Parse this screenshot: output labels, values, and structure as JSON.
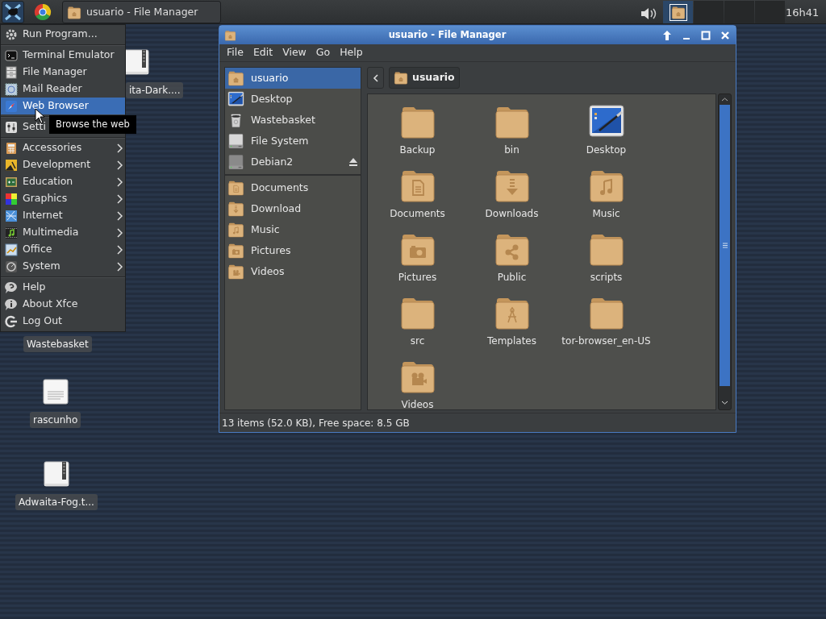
{
  "panel": {
    "task_button": {
      "label": "usuario - File Manager",
      "selected": false
    },
    "workspaces": [
      {
        "selected": true
      },
      {
        "selected": false
      },
      {
        "selected": false
      },
      {
        "selected": false
      }
    ],
    "clock": "16h41"
  },
  "desktop_icons": [
    {
      "label": "ita-Dark....",
      "kind": "archive"
    },
    {
      "label": "Wastebasket",
      "kind": "covered"
    },
    {
      "label": "rascunho",
      "kind": "text"
    },
    {
      "label": "Adwaita-Fog.t...",
      "kind": "archive"
    }
  ],
  "app_menu": {
    "sections": [
      [
        {
          "label": "Run Program...",
          "selected": false,
          "submenu": false
        }
      ],
      [
        {
          "label": "Terminal Emulator",
          "selected": false,
          "submenu": false
        },
        {
          "label": "File Manager",
          "selected": false,
          "submenu": false
        },
        {
          "label": "Mail Reader",
          "selected": false,
          "submenu": false
        },
        {
          "label": "Web Browser",
          "selected": true,
          "submenu": false
        }
      ],
      [
        {
          "label": "Setti",
          "selected": false,
          "submenu": false
        }
      ],
      [
        {
          "label": "Accessories",
          "selected": false,
          "submenu": true
        },
        {
          "label": "Development",
          "selected": false,
          "submenu": true
        },
        {
          "label": "Education",
          "selected": false,
          "submenu": true
        },
        {
          "label": "Graphics",
          "selected": false,
          "submenu": true
        },
        {
          "label": "Internet",
          "selected": false,
          "submenu": true
        },
        {
          "label": "Multimedia",
          "selected": false,
          "submenu": true
        },
        {
          "label": "Office",
          "selected": false,
          "submenu": true
        },
        {
          "label": "System",
          "selected": false,
          "submenu": true
        }
      ],
      [
        {
          "label": "Help",
          "selected": false,
          "submenu": false
        },
        {
          "label": "About Xfce",
          "selected": false,
          "submenu": false
        },
        {
          "label": "Log Out",
          "selected": false,
          "submenu": false
        }
      ]
    ]
  },
  "tooltip": "Browse the web",
  "file_manager": {
    "title": "usuario - File Manager",
    "menu": [
      "File",
      "Edit",
      "View",
      "Go",
      "Help"
    ],
    "sidebar": [
      [
        {
          "label": "usuario",
          "kind": "home",
          "selected": true,
          "eject": false
        },
        {
          "label": "Desktop",
          "kind": "desktop",
          "selected": false,
          "eject": false
        },
        {
          "label": "Wastebasket",
          "kind": "trash",
          "selected": false,
          "eject": false
        },
        {
          "label": "File System",
          "kind": "drive",
          "selected": false,
          "eject": false
        },
        {
          "label": "Debian2",
          "kind": "disk",
          "selected": false,
          "eject": true
        }
      ],
      [
        {
          "label": "Documents",
          "kind": "documents",
          "selected": false,
          "eject": false
        },
        {
          "label": "Download",
          "kind": "downloads",
          "selected": false,
          "eject": false
        },
        {
          "label": "Music",
          "kind": "music",
          "selected": false,
          "eject": false
        },
        {
          "label": "Pictures",
          "kind": "pictures",
          "selected": false,
          "eject": false
        },
        {
          "label": "Videos",
          "kind": "videos",
          "selected": false,
          "eject": false
        }
      ]
    ],
    "path": "usuario",
    "items": [
      {
        "label": "Backup",
        "kind": "folder",
        "selected": false
      },
      {
        "label": "bin",
        "kind": "folder",
        "selected": false
      },
      {
        "label": "Desktop",
        "kind": "desktop",
        "selected": false
      },
      {
        "label": "Documents",
        "kind": "documents",
        "selected": false
      },
      {
        "label": "Downloads",
        "kind": "downloads",
        "selected": false
      },
      {
        "label": "Music",
        "kind": "music",
        "selected": false
      },
      {
        "label": "Pictures",
        "kind": "pictures",
        "selected": false
      },
      {
        "label": "Public",
        "kind": "public",
        "selected": false
      },
      {
        "label": "scripts",
        "kind": "folder",
        "selected": false
      },
      {
        "label": "src",
        "kind": "folder",
        "selected": false
      },
      {
        "label": "Templates",
        "kind": "templates",
        "selected": false
      },
      {
        "label": "tor-browser_en-US",
        "kind": "folder",
        "selected": false
      },
      {
        "label": "Videos",
        "kind": "videos",
        "selected": false
      }
    ],
    "status": "13 items (52.0 KB), Free space: 8.5 GB"
  }
}
